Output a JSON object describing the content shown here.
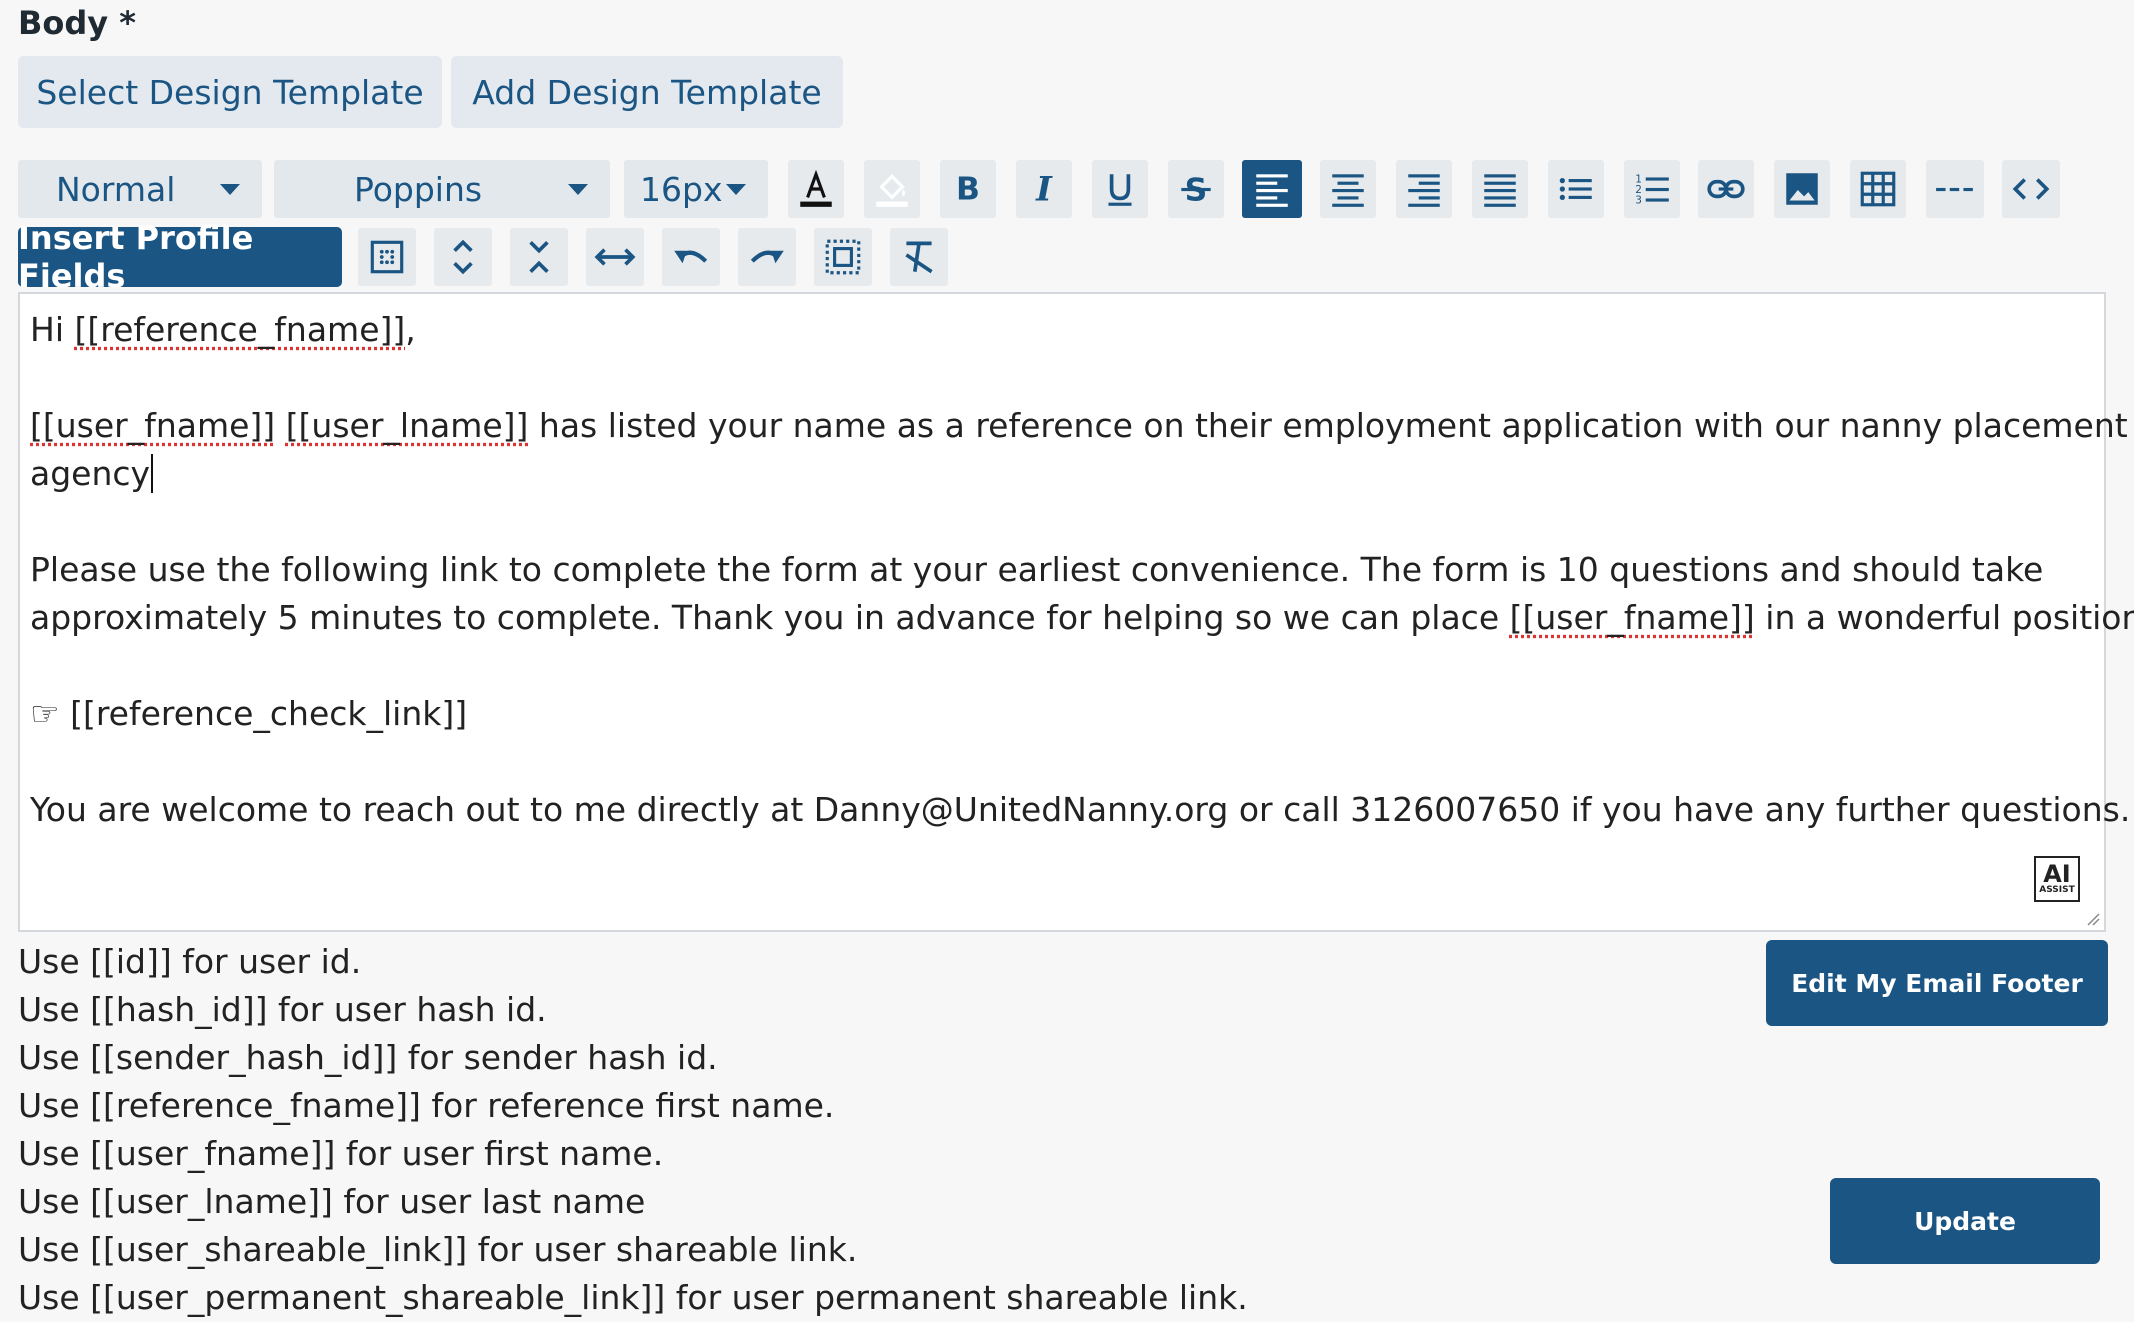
{
  "form": {
    "body_label": "Body *"
  },
  "templates": {
    "select_label": "Select Design Template",
    "add_label": "Add Design Template"
  },
  "toolbar": {
    "format_value": "Normal",
    "font_value": "Poppins",
    "size_value": "16px",
    "insert_label": "Insert Profile Fields",
    "row1_icons": [
      "text-color-icon",
      "highlight-color-icon",
      "bold-icon",
      "italic-icon",
      "underline-icon",
      "strikethrough-icon",
      "align-left-icon",
      "align-center-icon",
      "align-right-icon",
      "align-justify-icon",
      "bullet-list-icon",
      "numbered-list-icon",
      "link-icon",
      "image-icon",
      "table-icon",
      "horizontal-rule-icon",
      "code-view-icon"
    ],
    "row2_icons": [
      "insert-table-icon",
      "expand-vertical-icon",
      "collapse-vertical-icon",
      "expand-horizontal-icon",
      "undo-icon",
      "redo-icon",
      "select-all-icon",
      "clear-formatting-icon"
    ]
  },
  "editor": {
    "greeting_prefix": "Hi ",
    "greeting_token": "[[reference_fname]]",
    "greeting_suffix": ",",
    "p2_token1": "[[user_fname]]",
    "p2_token2": "[[user_lname]]",
    "p2_rest": " has listed your name as a reference on their employment application with our nanny placement",
    "p2_line2": "agency",
    "p3_line1": "Please use the following link to complete the form at your earliest convenience.  The form is 10 questions and should take",
    "p3_line2_prefix": "approximately 5 minutes to complete. Thank you in advance for helping so we can place ",
    "p3_token": "[[user_fname]]",
    "p3_line2_suffix": " in a wonderful position.",
    "link_line": "☞ [[reference_check_link]]",
    "contact_line": "You are welcome to reach out to me directly at Danny@UnitedNanny.org or call 3126007650 if you have any further questions.",
    "ai_badge_top": "AI",
    "ai_badge_bottom": "ASSIST"
  },
  "help": {
    "lines": [
      "Use [[id]] for user id.",
      "Use [[hash_id]] for user hash id.",
      "Use [[sender_hash_id]] for sender hash id.",
      "Use [[reference_fname]] for reference first name.",
      "Use [[user_fname]] for user first name.",
      "Use [[user_lname]] for user last name",
      "Use [[user_shareable_link]] for user shareable link.",
      "Use [[user_permanent_shareable_link]] for user permanent shareable link."
    ]
  },
  "actions": {
    "edit_footer_label": "Edit My Email Footer",
    "update_label": "Update"
  },
  "colors": {
    "primary": "#1b5583",
    "light_button": "#e3e9ee",
    "toolbar_button": "#e6eaed"
  }
}
